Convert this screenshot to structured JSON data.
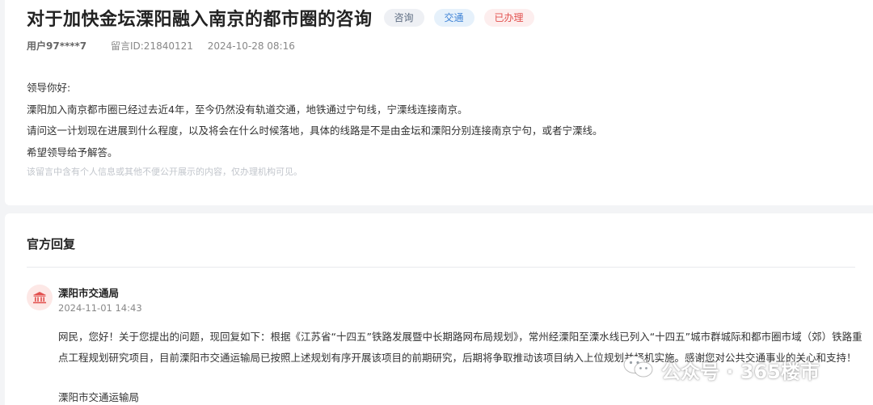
{
  "message": {
    "title": "对于加快金坛溧阳融入南京的都市圈的咨询",
    "tags": {
      "type": "咨询",
      "category": "交通",
      "status": "已办理"
    },
    "user": "用户97****7",
    "message_id": "留言ID:21840121",
    "datetime": "2024-10-28 08:16",
    "body": [
      "领导你好:",
      "溧阳加入南京都市圈已经过去近4年，至今仍然没有轨道交通，地铁通过宁句线，宁溧线连接南京。",
      "请问这一计划现在进展到什么程度，以及将会在什么时候落地，具体的线路是不是由金坛和溧阳分别连接南京宁句，或者宁溧线。",
      "希望领导给予解答。"
    ],
    "privacy_note": "该留言中含有个人信息或其他不便公开展示的内容，仅办理机构可见。"
  },
  "reply": {
    "heading": "官方回复",
    "org_name": "溧阳市交通局",
    "datetime": "2024-11-01 14:43",
    "text": "网民，您好！关于您提出的问题，现回复如下：根据《江苏省“十四五”铁路发展暨中长期路网布局规划》，常州经溧阳至溧水线已列入“十四五”城市群城际和都市圈市域（郊）铁路重点工程规划研究项目，目前溧阳市交通运输局已按照上述规划有序开展该项目的前期研究，后期将争取推动该项目纳入上位规划并择机实施。感谢您对公共交通事业的关心和支持！",
    "signature": "溧阳市交通运输局"
  },
  "watermark": {
    "text": "公众号 · 365楼市"
  },
  "icons": {
    "org": "government-building-icon",
    "watermark": "wechat-icon"
  },
  "colors": {
    "tag_consult_text": "#5c6b80",
    "tag_traffic_text": "#3f83d6",
    "tag_done_text": "#e2514f",
    "org_icon": "#e2514f"
  }
}
